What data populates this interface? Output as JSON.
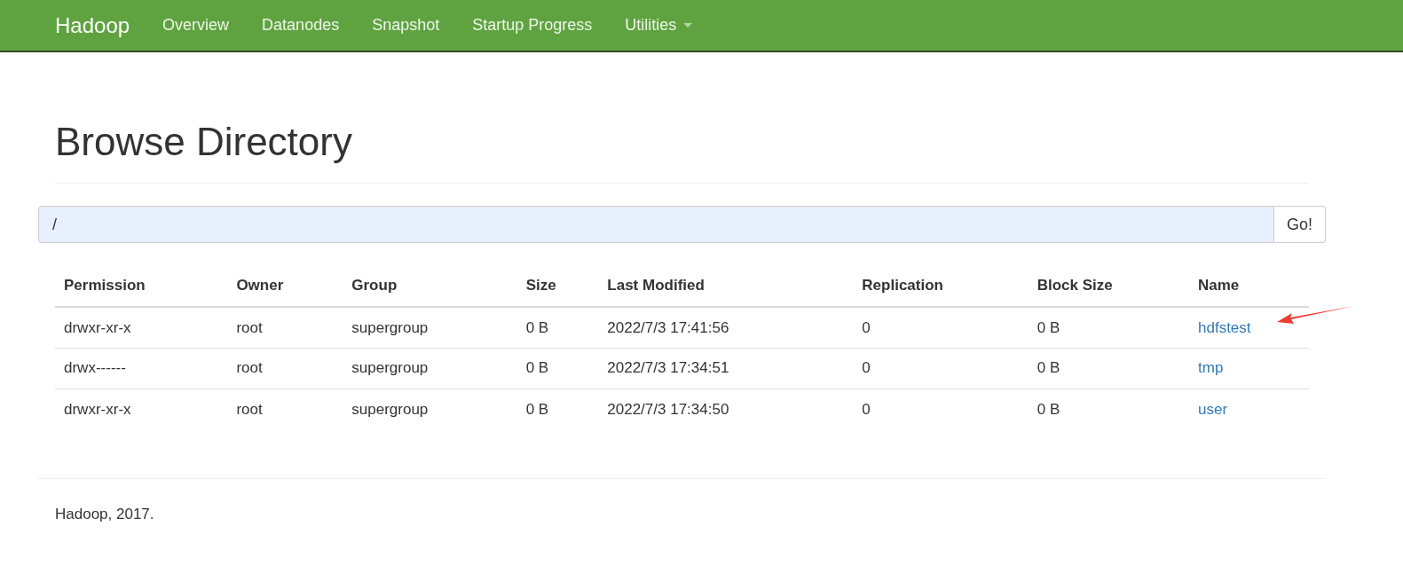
{
  "navbar": {
    "brand": "Hadoop",
    "items": [
      {
        "label": "Overview",
        "dropdown": false
      },
      {
        "label": "Datanodes",
        "dropdown": false
      },
      {
        "label": "Snapshot",
        "dropdown": false
      },
      {
        "label": "Startup Progress",
        "dropdown": false
      },
      {
        "label": "Utilities",
        "dropdown": true
      }
    ]
  },
  "heading": "Browse Directory",
  "path_field": {
    "value": "/",
    "button": "Go!"
  },
  "table": {
    "columns": [
      "Permission",
      "Owner",
      "Group",
      "Size",
      "Last Modified",
      "Replication",
      "Block Size",
      "Name"
    ],
    "rows": [
      [
        "drwxr-xr-x",
        "root",
        "supergroup",
        "0 B",
        "2022/7/3 17:41:56",
        "0",
        "0 B",
        "hdfstest"
      ],
      [
        "drwx------",
        "root",
        "supergroup",
        "0 B",
        "2022/7/3 17:34:51",
        "0",
        "0 B",
        "tmp"
      ],
      [
        "drwxr-xr-x",
        "root",
        "supergroup",
        "0 B",
        "2022/7/3 17:34:50",
        "0",
        "0 B",
        "user"
      ]
    ]
  },
  "footer": "Hadoop, 2017."
}
